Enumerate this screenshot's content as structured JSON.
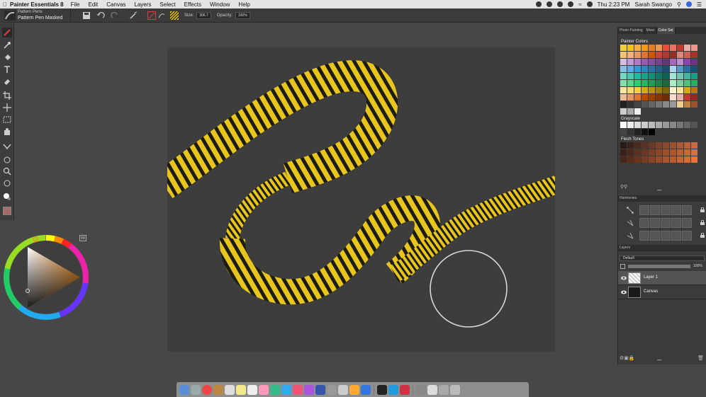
{
  "menubar": {
    "app_name": "Painter Essentials 8",
    "menus": [
      "File",
      "Edit",
      "Canvas",
      "Layers",
      "Select",
      "Effects",
      "Window",
      "Help"
    ],
    "clock": "Thu 2:23 PM",
    "user": "Sarah Swango"
  },
  "property_bar": {
    "brush_category": "Pattern Pens",
    "brush_variant": "Pattern Pen Masked",
    "size_label": "Size:",
    "size_value": "306.7",
    "opacity_label": "Opacity:",
    "opacity_value": "100%"
  },
  "color_panel": {
    "tabs": [
      "Photo Painting",
      "Mixer",
      "Color Set"
    ],
    "active_tab": "Color Set",
    "painter_colors_title": "Painter Colors",
    "grayscale_title": "Grayscale",
    "flesh_tones_title": "Flesh Tones"
  },
  "harmonies": {
    "title": "Harmonies"
  },
  "layers": {
    "title": "Layers",
    "composite_method": "Default",
    "opacity": "100%",
    "items": [
      {
        "name": "Layer 1",
        "selected": true
      },
      {
        "name": "Canvas",
        "selected": false
      }
    ]
  },
  "colors": {
    "stripe_yellow": "#e8c51c",
    "stripe_dark": "#1c1c12",
    "canvas_bg": "#3d3d3d",
    "accent_orange": "#f08c1a"
  }
}
